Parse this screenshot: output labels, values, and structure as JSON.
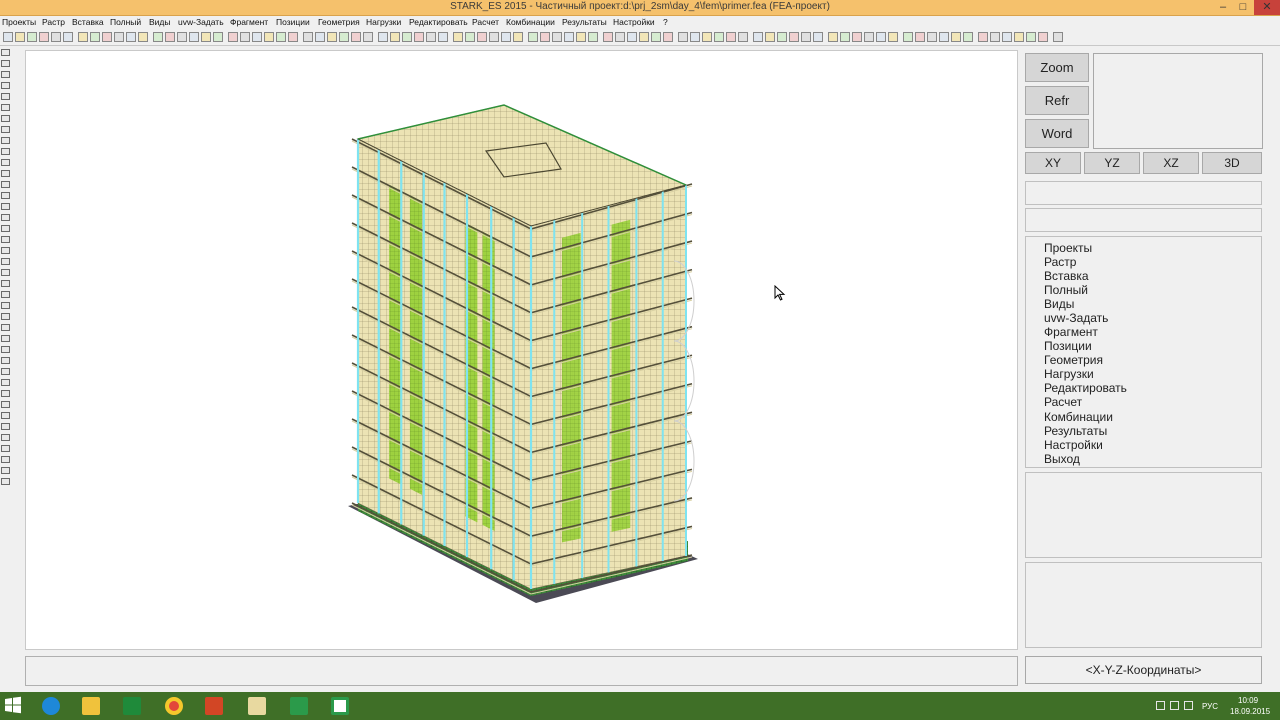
{
  "window": {
    "title": "STARK_ES 2015 - Частичный проект:d:\\prj_2sm\\day_4\\fem\\primer.fea (FEA-проект)",
    "min_glyph": "–",
    "max_glyph": "□",
    "close_glyph": "✕"
  },
  "menu": [
    "Проекты",
    "Растр",
    "Вставка",
    "Полный",
    "Виды",
    "uvw-Задать",
    "Фрагмент",
    "Позиции",
    "Геометрия",
    "Нагрузки",
    "Редактировать",
    "Расчет",
    "Комбинации",
    "Результаты",
    "Настройки",
    "?"
  ],
  "right_panel": {
    "zoom": "Zoom",
    "refr": "Refr",
    "word": "Word",
    "views": [
      "XY",
      "YZ",
      "XZ",
      "3D"
    ],
    "menu_items": [
      "Проекты",
      "Растр",
      "Вставка",
      "Полный",
      "Виды",
      "uvw-Задать",
      "Фрагмент",
      "Позиции",
      "Геометрия",
      "Нагрузки",
      "Редактировать",
      "Расчет",
      "Комбинации",
      "Результаты",
      "Настройки",
      "Выход"
    ],
    "coords": "<X-Y-Z-Координаты>"
  },
  "taskbar": {
    "apps": [
      "ie-icon",
      "explorer-icon",
      "excel-icon",
      "chrome-icon",
      "powerpoint-icon",
      "stark-icon",
      "app-green-icon",
      "app-c-icon"
    ],
    "lang": "РУС",
    "time": "10:09",
    "date": "18.09.2015"
  },
  "colors": {
    "titlebar": "#f5c16c",
    "slab": "#e9e1b6",
    "wall_green": "#9ad13a",
    "column_cyan": "#7fe3f0",
    "foundation": "#2f7a2f"
  }
}
